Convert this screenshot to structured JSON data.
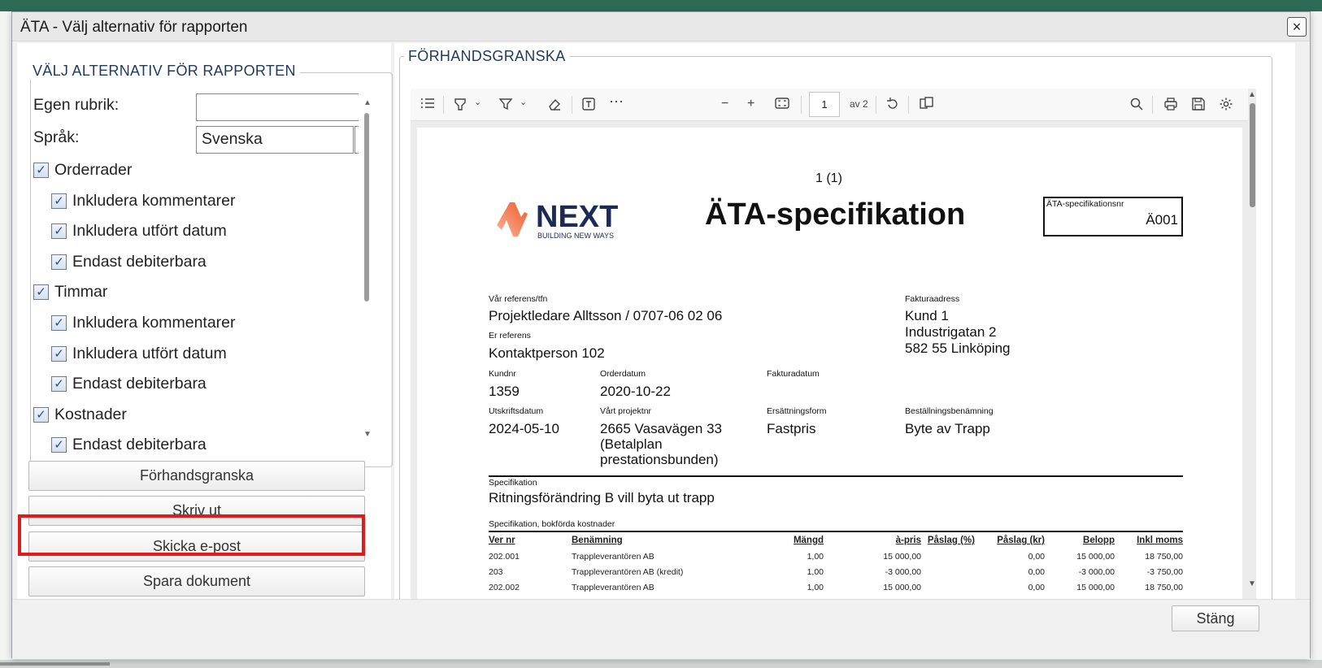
{
  "dialog": {
    "title": "ÄTA - Välj alternativ för rapporten",
    "close_icon": "×",
    "footer_close_label": "Stäng"
  },
  "options": {
    "legend": "VÄLJ ALTERNATIV FÖR RAPPORTEN",
    "custom_title_label": "Egen rubrik:",
    "custom_title_value": "",
    "language_label": "Språk:",
    "language_value": "Svenska",
    "checks": [
      {
        "label": "Orderrader",
        "checked": true,
        "level": 0
      },
      {
        "label": "Inkludera kommentarer",
        "checked": true,
        "level": 1
      },
      {
        "label": "Inkludera utfört datum",
        "checked": true,
        "level": 1
      },
      {
        "label": "Endast debiterbara",
        "checked": true,
        "level": 1
      },
      {
        "label": "Timmar",
        "checked": true,
        "level": 0
      },
      {
        "label": "Inkludera kommentarer",
        "checked": true,
        "level": 1
      },
      {
        "label": "Inkludera utfört datum",
        "checked": true,
        "level": 1
      },
      {
        "label": "Endast debiterbara",
        "checked": true,
        "level": 1
      },
      {
        "label": "Kostnader",
        "checked": true,
        "level": 0
      },
      {
        "label": "Endast debiterbara",
        "checked": true,
        "level": 1
      }
    ]
  },
  "actions": {
    "preview": "Förhandsgranska",
    "print": "Skriv ut",
    "email": "Skicka e-post",
    "save": "Spara dokument"
  },
  "preview": {
    "legend": "FÖRHANDSGRANSKA",
    "toolbar": {
      "page_current": "1",
      "page_of": "av 2",
      "icons": [
        "list-icon",
        "highlight-icon",
        "chevron-down-icon",
        "filter-icon",
        "chevron-down-icon",
        "eraser-icon",
        "text-box-icon",
        "more-icon",
        "zoom-out-icon",
        "zoom-in-icon",
        "fit-page-icon",
        "rotate-icon",
        "page-view-icon",
        "search-icon",
        "print-icon",
        "save-icon",
        "settings-icon"
      ]
    },
    "document": {
      "page_indicator": "1 (1)",
      "logo_brand": "NEXT",
      "logo_tagline": "BUILDING NEW WAYS",
      "title": "ÄTA-specifikation",
      "spec_label": "ÄTA-specifikationsnr",
      "spec_value": "Ä001",
      "our_ref_label": "Vår referens/tfn",
      "our_ref_value": "Projektledare Alltsson / 0707-06 02 06",
      "your_ref_label": "Er referens",
      "your_ref_value": "Kontaktperson 102",
      "invoice_addr_label": "Fakturaadress",
      "invoice_addr_1": "Kund 1",
      "invoice_addr_2": "Industrigatan 2",
      "invoice_addr_3": "582 55 Linköping",
      "customer_no_label": "Kundnr",
      "customer_no_value": "1359",
      "order_date_label": "Orderdatum",
      "order_date_value": "2020-10-22",
      "invoice_date_label": "Fakturadatum",
      "print_date_label": "Utskriftsdatum",
      "print_date_value": "2024-05-10",
      "project_label": "Vårt projektnr",
      "project_value_1": "2665 Vasavägen 33",
      "project_value_2": "(Betalplan",
      "project_value_3": "prestationsbunden)",
      "compensation_label": "Ersättningsform",
      "compensation_value": "Fastpris",
      "order_name_label": "Beställningsbenämning",
      "order_name_value": "Byte av Trapp",
      "specification_label": "Specifikation",
      "specification_value": "Ritningsförändring B vill byta ut trapp",
      "costs_label": "Specifikation, bokförda kostnader",
      "table_headers": [
        "Ver nr",
        "Benämning",
        "Mängd",
        "à-pris",
        "Påslag (%)",
        "Påslag (kr)",
        "Belopp",
        "Inkl moms"
      ],
      "table_rows": [
        [
          "202.001",
          "Trappleverantören AB",
          "1,00",
          "15 000,00",
          "",
          "0,00",
          "15 000,00",
          "18 750,00"
        ],
        [
          "203",
          "Trappleverantören AB (kredit)",
          "1,00",
          "-3 000,00",
          "",
          "0,00",
          "-3 000,00",
          "-3 750,00"
        ],
        [
          "202.002",
          "Trappleverantören AB",
          "1,00",
          "15 000,00",
          "",
          "0,00",
          "15 000,00",
          "18 750,00"
        ]
      ]
    }
  },
  "colors": {
    "accent_red": "#e01b1b",
    "header_green": "#2e6b57",
    "legend_blue": "#1f3a5a",
    "logo_orange": "#f26b3a",
    "logo_navy": "#1d2a55"
  }
}
